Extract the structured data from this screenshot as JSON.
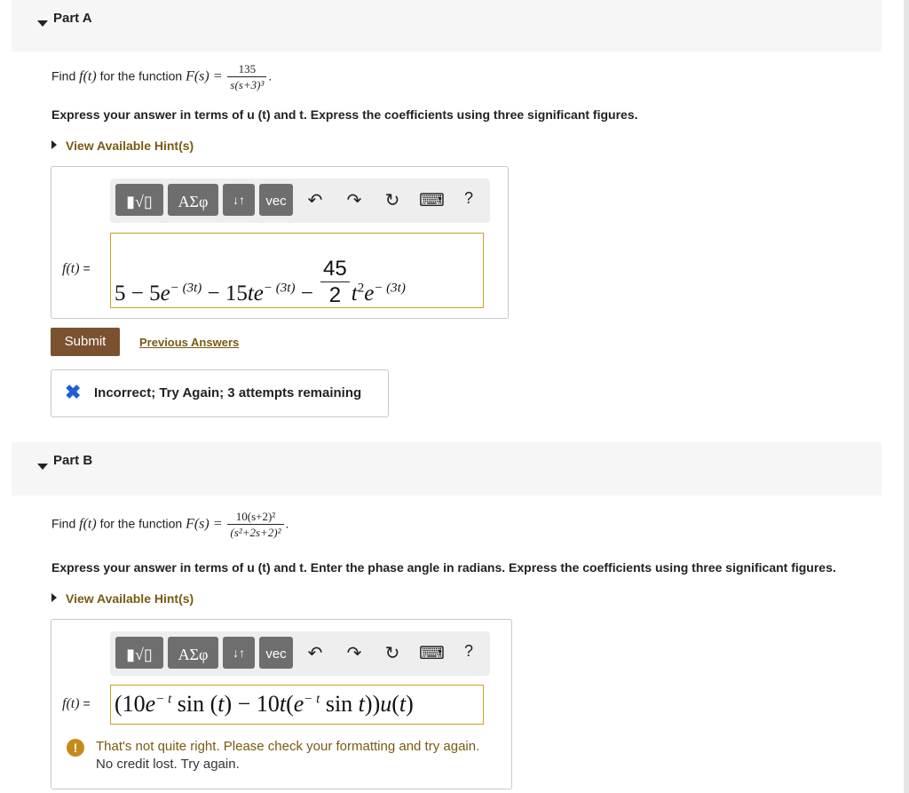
{
  "partA": {
    "title": "Part A",
    "question_prefix": "Find",
    "question_mid": "for the function",
    "ft": "f(t)",
    "Fs": "F(s) =",
    "numerator": "135",
    "denominator": "s(s+3)³",
    "instruction": "Express your answer in terms of u (t) and t. Express the coefficients using three significant figures.",
    "hint": "View Available Hint(s)",
    "toolbar": {
      "templates": "▮√▯",
      "greek": "ΑΣφ",
      "arrows": "↓↑",
      "vec": "vec",
      "undo": "↶",
      "redo": "↷",
      "reset": "↻",
      "keyboard": "⌨",
      "help": "?"
    },
    "answer_label": "f(t)",
    "answer_eq": "=",
    "answer": {
      "t1": "5 − 5",
      "e1": "e",
      "s1": "− (3t)",
      "t2": " − 15",
      "te": "te",
      "s2": "− (3t)",
      "minus": " − ",
      "num": "45",
      "den": "2",
      "t3": "t",
      "s3": "2",
      "e3": "e",
      "s4": "− (3t)"
    },
    "submit": "Submit",
    "previous": "Previous Answers",
    "feedback": "Incorrect; Try Again; 3 attempts remaining"
  },
  "partB": {
    "title": "Part B",
    "question_prefix": "Find",
    "question_mid": "for the function",
    "ft": "f(t)",
    "Fs": "F(s) =",
    "numerator": "10(s+2)²",
    "denominator": "(s²+2s+2)²",
    "instruction": "Express your answer in terms of u (t) and t. Enter the phase angle in radians. Express the coefficients using three significant figures.",
    "hint": "View Available Hint(s)",
    "toolbar": {
      "templates": "▮√▯",
      "greek": "ΑΣφ",
      "arrows": "↓↑",
      "vec": "vec",
      "undo": "↶",
      "redo": "↷",
      "reset": "↻",
      "keyboard": "⌨",
      "help": "?"
    },
    "answer_label": "f(t)",
    "answer_eq": "=",
    "answer": {
      "a1": "(10",
      "e1": "e",
      "s1": "− t",
      "a2": " sin (",
      "t1": "t",
      "a3": ") − 10",
      "t2": "t",
      "a4": "(",
      "e2": "e",
      "s2": "− t",
      "a5": " sin ",
      "t3": "t",
      "a6": "))",
      "u": "u",
      "a7": "(",
      "t4": "t",
      "a8": ")"
    },
    "warning": "That's not quite right. Please check your formatting and try again.",
    "warning_sub": "No credit lost. Try again."
  },
  "colors": {
    "accent": "#7a5230",
    "hint": "#7a5a12",
    "field_border": "#c8a326",
    "error_x": "#1f5fd1"
  }
}
